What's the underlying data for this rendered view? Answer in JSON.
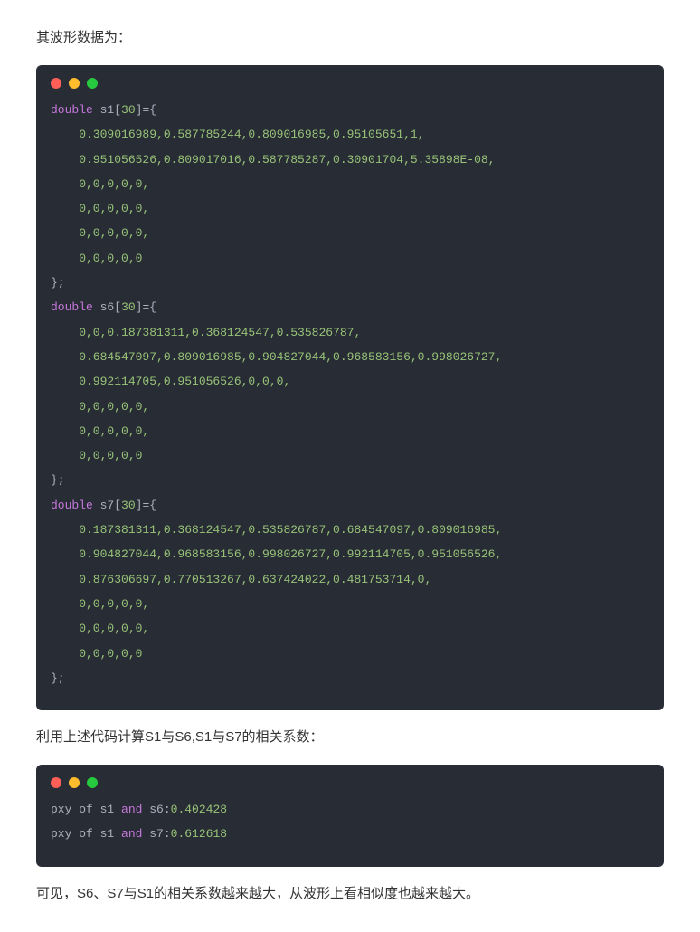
{
  "intro_text": "其波形数据为：",
  "mid_text": "利用上述代码计算S1与S6,S1与S7的相关系数：",
  "conclusion_text": "可见，S6、S7与S1的相关系数越来越大，从波形上看相似度也越来越大。",
  "code1": {
    "s1": {
      "decl_kw": "double",
      "decl_name": " s1[",
      "decl_size": "30",
      "decl_close": "]={",
      "lines": [
        "    0.309016989,0.587785244,0.809016985,0.95105651,1,",
        "    0.951056526,0.809017016,0.587785287,0.30901704,5.35898E-08,",
        "    0,0,0,0,0,",
        "    0,0,0,0,0,",
        "    0,0,0,0,0,",
        "    0,0,0,0,0"
      ],
      "close": "};"
    },
    "s6": {
      "decl_kw": "double",
      "decl_name": " s6[",
      "decl_size": "30",
      "decl_close": "]={",
      "lines": [
        "    0,0,0.187381311,0.368124547,0.535826787,",
        "    0.684547097,0.809016985,0.904827044,0.968583156,0.998026727,",
        "    0.992114705,0.951056526,0,0,0,",
        "    0,0,0,0,0,",
        "    0,0,0,0,0,",
        "    0,0,0,0,0"
      ],
      "close": "};"
    },
    "s7": {
      "decl_kw": "double",
      "decl_name": " s7[",
      "decl_size": "30",
      "decl_close": "]={",
      "lines": [
        "    0.187381311,0.368124547,0.535826787,0.684547097,0.809016985,",
        "    0.904827044,0.968583156,0.998026727,0.992114705,0.951056526,",
        "    0.876306697,0.770513267,0.637424022,0.481753714,0,",
        "    0,0,0,0,0,",
        "    0,0,0,0,0,",
        "    0,0,0,0,0"
      ],
      "close": "};"
    }
  },
  "code2": {
    "line1_pre": "pxy of s1 ",
    "line1_and": "and",
    "line1_post": " s6:",
    "line1_val": "0.402428",
    "line2_pre": "pxy of s1 ",
    "line2_and": "and",
    "line2_post": " s7:",
    "line2_val": "0.612618"
  }
}
